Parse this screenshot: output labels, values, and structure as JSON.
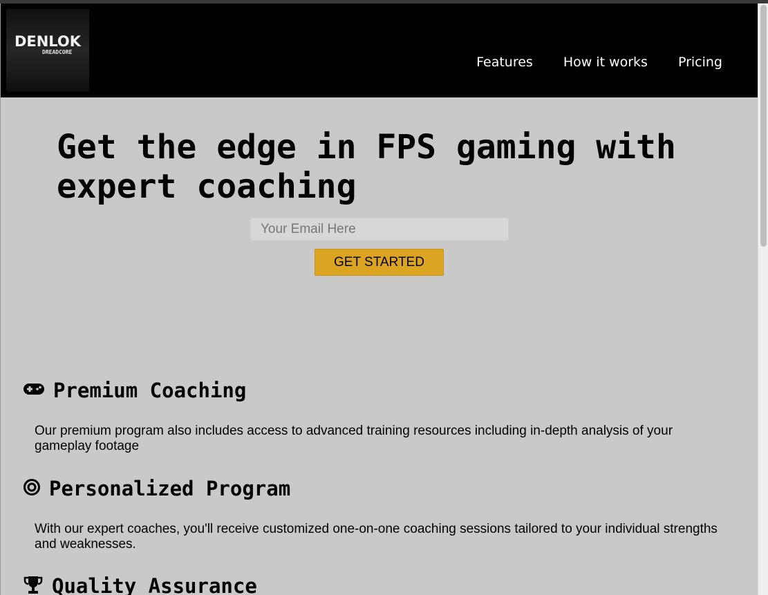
{
  "brand": {
    "logo_text": "DENLOK",
    "logo_subtext": "DREADCORE"
  },
  "nav": {
    "items": [
      "Features",
      "How it works",
      "Pricing"
    ]
  },
  "hero": {
    "title": "Get the edge in FPS gaming with expert coaching",
    "email_placeholder": "Your Email Here",
    "cta_label": "GET STARTED"
  },
  "features": [
    {
      "icon": "gamepad-icon",
      "title": "Premium Coaching",
      "text": "Our premium program also includes access to advanced training resources including in-depth analysis of your gameplay footage"
    },
    {
      "icon": "target-icon",
      "title": "Personalized Program",
      "text": "With our expert coaches, you'll receive customized one-on-one coaching sessions tailored to your individual strengths and weaknesses."
    },
    {
      "icon": "trophy-icon",
      "title": "Quality Assurance",
      "text": ""
    }
  ],
  "colors": {
    "header_bg": "#000000",
    "page_bg": "#c9c9c9",
    "accent": "#dba421"
  }
}
